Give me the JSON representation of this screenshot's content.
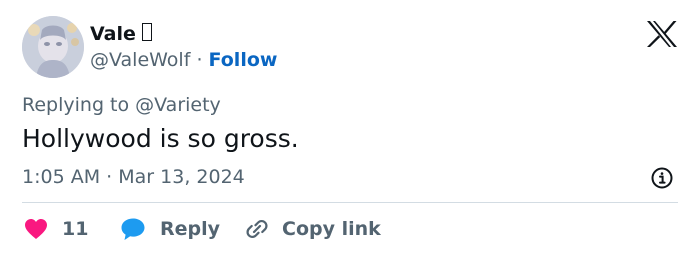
{
  "tweet": {
    "author": {
      "display_name": "Vale",
      "handle": "@ValeWolf",
      "separator": "·",
      "follow_label": "Follow"
    },
    "reply_context": "Replying to @Variety",
    "text": "Hollywood is so gross.",
    "time": "1:05 AM",
    "meta_separator": "·",
    "date": "Mar 13, 2024",
    "actions": {
      "like_count": "11",
      "reply_label": "Reply",
      "copy_label": "Copy link"
    }
  },
  "icons": {
    "brand": "x-logo-icon",
    "info": "info-icon",
    "like": "heart-icon",
    "reply": "speech-bubble-icon",
    "copy": "link-icon"
  },
  "colors": {
    "text": "#0f1419",
    "secondary": "#536471",
    "follow": "#0a66c2",
    "heart": "#f91880",
    "reply_bubble": "#1d9bf0",
    "divider": "#d3dce3"
  }
}
